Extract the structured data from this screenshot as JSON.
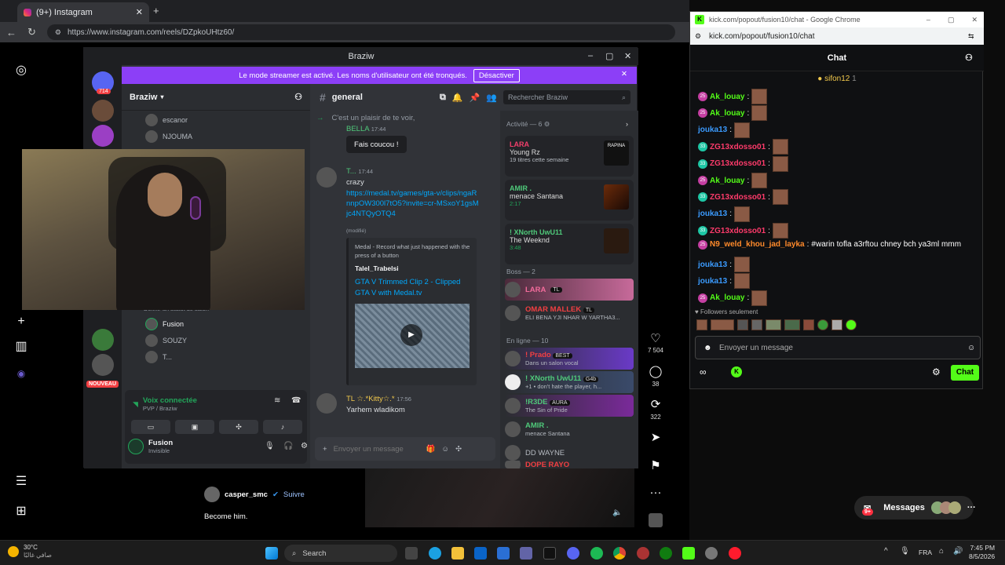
{
  "browser": {
    "tab_title": "(9+) Instagram",
    "url": "https://www.instagram.com/reels/DZpkoUHtz60/"
  },
  "discord": {
    "window_title": "Braziw",
    "banner_text": "Le mode streamer est activé. Les noms d'utilisateur ont été tronqués.",
    "banner_button": "Désactiver",
    "guild_badge": "714",
    "server_name": "Braziw",
    "channel": "general",
    "search_placeholder": "Rechercher Braziw",
    "voice_users_top": [
      "escanor",
      "NJOUMA"
    ],
    "voice_users_bottom": [
      "Fusion",
      "SOUZY",
      "T..."
    ],
    "status_hint": "Définir un statut de salon",
    "nouveau": "NOUVEAU",
    "voice_connected": "Voix connectée",
    "voice_sub": "PVP / Braziw",
    "user_name": "Fusion",
    "user_status": "Invisible",
    "messages": [
      {
        "text": "C'est un plaisir de te voir,"
      },
      {
        "author": "BELLA",
        "time": "17:44"
      },
      {
        "button": "Fais coucou !"
      },
      {
        "author": "T...",
        "time": "17:44",
        "text": "crazy",
        "link": "https://medal.tv/games/gta-v/clips/ngaRnnpOW300l7tO5?invite=cr-MSxoY1gsMjc4NTQyOTQ4",
        "edited": "(modifié)"
      },
      {
        "embed_site": "Medal - Record what just happened with the press of a button",
        "embed_author": "Talel_Trabelsi",
        "embed_title": "GTA V Trimmed Clip 2 - Clipped GTA V with Medal.tv"
      },
      {
        "author": "TL",
        "author2": "☆.*Kitty☆.*",
        "time": "17:56",
        "text": "Yarhem wladikom"
      }
    ],
    "composer_placeholder": "Envoyer un message",
    "activity_header": "Activité — 6",
    "activities": [
      {
        "name": "LARA",
        "line1": "Young Rz",
        "line2": "19 titres cette semaine",
        "thumb": "RAPINA"
      },
      {
        "name": "AMIR .",
        "line1": "menace Santana",
        "line2": "2:17"
      },
      {
        "name": "! XNorth UwU11",
        "line1": "The Weeknd",
        "line2": "3:48"
      }
    ],
    "boss_header": "Boss — 2",
    "boss": [
      {
        "name": "LARA",
        "tag": "TL"
      },
      {
        "name": "OMAR MALLEK",
        "tag": "TL",
        "sub": "ELI BENA YJI NHAR W YARTHA3..."
      }
    ],
    "online_header": "En ligne — 10",
    "online": [
      {
        "name": "! Prado",
        "tag": "BEST",
        "sub": "Dans un salon vocal"
      },
      {
        "name": "! XNorth UwU11",
        "tag": "G4b",
        "sub": "+1 • don't hate the player, h..."
      },
      {
        "name": "!R3DE",
        "tag": "AURA",
        "sub": "The Sin of Pride"
      },
      {
        "name": "AMIR .",
        "sub": "menace Santana"
      },
      {
        "name": "DD WAYNE"
      },
      {
        "name": "DOPE RAYO"
      }
    ]
  },
  "instagram": {
    "user": "casper_smc",
    "follow": "Suivre",
    "caption": "Become him.",
    "likes": "7 504",
    "comments": "38",
    "reposts": "322",
    "messages_label": "Messages",
    "messages_badge": "9+"
  },
  "kick": {
    "window_title": "kick.com/popout/fusion10/chat - Google Chrome",
    "address": "kick.com/popout/fusion10/chat",
    "title": "Chat",
    "pinned_user": "sifon12",
    "pinned_count": "1",
    "messages": [
      {
        "user": "Ak_louay",
        "badge": "25",
        "color": "#53fc18",
        "emotes": 1
      },
      {
        "user": "Ak_louay",
        "badge": "25",
        "color": "#53fc18",
        "emotes": 1
      },
      {
        "user": "jouka13",
        "badge": "",
        "color": "#3b9bff",
        "emotes": 1
      },
      {
        "user": "ZG13xdosso01",
        "badge": "33",
        "color": "#ff3b6b",
        "emotes": 1
      },
      {
        "user": "ZG13xdosso01",
        "badge": "33",
        "color": "#ff3b6b",
        "emotes": 1
      },
      {
        "user": "Ak_louay",
        "badge": "25",
        "color": "#53fc18",
        "emotes": 1
      },
      {
        "user": "ZG13xdosso01",
        "badge": "33",
        "color": "#ff3b6b",
        "emotes": 1
      },
      {
        "user": "jouka13",
        "badge": "",
        "color": "#3b9bff",
        "emotes": 1
      },
      {
        "user": "ZG13xdosso01",
        "badge": "33",
        "color": "#ff3b6b",
        "emotes": 1
      },
      {
        "user": "N9_weld_khou_jad_layka",
        "badge": "25",
        "color": "#ff8a2b",
        "text": "#warin tofla a3rftou chney bch ya3ml mmm"
      },
      {
        "user": "jouka13",
        "badge": "",
        "color": "#3b9bff",
        "emotes": 1
      },
      {
        "user": "jouka13",
        "badge": "",
        "color": "#3b9bff",
        "emotes": 1
      },
      {
        "user": "Ak_louay",
        "badge": "25",
        "color": "#53fc18",
        "emotes": 1
      }
    ],
    "followers_only": "Followers seulement",
    "input_placeholder": "Envoyer un message",
    "chat_button": "Chat",
    "accent": "#53fc18"
  },
  "taskbar": {
    "weather_temp": "30°C",
    "weather_desc": "صافي غالبًا",
    "search": "Search",
    "lang": "FRA",
    "time": "7:45 PM",
    "date": "8/5/2026"
  }
}
